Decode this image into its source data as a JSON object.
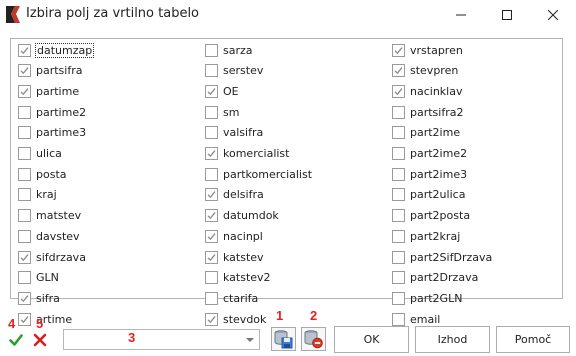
{
  "window": {
    "title": "Izbira polj za vrtilno tabelo",
    "minimize_glyph": "—",
    "maximize_glyph": "☐",
    "close_glyph": "✕"
  },
  "columns": [
    [
      {
        "label": "datumzap",
        "checked": true
      },
      {
        "label": "partsifra",
        "checked": true
      },
      {
        "label": "partime",
        "checked": true
      },
      {
        "label": "partime2",
        "checked": false
      },
      {
        "label": "partime3",
        "checked": false
      },
      {
        "label": "ulica",
        "checked": false
      },
      {
        "label": "posta",
        "checked": false
      },
      {
        "label": "kraj",
        "checked": false
      },
      {
        "label": "matstev",
        "checked": false
      },
      {
        "label": "davstev",
        "checked": false
      },
      {
        "label": "sifdrzava",
        "checked": true
      },
      {
        "label": "GLN",
        "checked": false
      },
      {
        "label": "sifra",
        "checked": true
      },
      {
        "label": "artime",
        "checked": true
      }
    ],
    [
      {
        "label": "sarza",
        "checked": false
      },
      {
        "label": "serstev",
        "checked": false
      },
      {
        "label": "OE",
        "checked": true
      },
      {
        "label": "sm",
        "checked": false
      },
      {
        "label": "valsifra",
        "checked": false
      },
      {
        "label": "komercialist",
        "checked": true
      },
      {
        "label": "partkomercialist",
        "checked": false
      },
      {
        "label": "delsifra",
        "checked": true
      },
      {
        "label": "datumdok",
        "checked": true
      },
      {
        "label": "nacinpl",
        "checked": true
      },
      {
        "label": "katstev",
        "checked": true
      },
      {
        "label": "katstev2",
        "checked": false
      },
      {
        "label": "ctarifa",
        "checked": false
      },
      {
        "label": "stevdok",
        "checked": true
      }
    ],
    [
      {
        "label": "vrstapren",
        "checked": true
      },
      {
        "label": "stevpren",
        "checked": true
      },
      {
        "label": "nacinklav",
        "checked": true
      },
      {
        "label": "partsifra2",
        "checked": false
      },
      {
        "label": "part2ime",
        "checked": false
      },
      {
        "label": "part2ime2",
        "checked": false
      },
      {
        "label": "part2ime3",
        "checked": false
      },
      {
        "label": "part2ulica",
        "checked": false
      },
      {
        "label": "part2posta",
        "checked": false
      },
      {
        "label": "part2kraj",
        "checked": false
      },
      {
        "label": "part2SifDrzava",
        "checked": false
      },
      {
        "label": "part2Drzava",
        "checked": false
      },
      {
        "label": "part2GLN",
        "checked": false
      },
      {
        "label": "email",
        "checked": false
      }
    ]
  ],
  "combo": {
    "value": ""
  },
  "buttons": {
    "ok": "OK",
    "izhod": "Izhod",
    "pomoc": "Pomoč"
  },
  "annotations": {
    "a1": "1",
    "a2": "2",
    "a3": "3",
    "a4": "4",
    "a5": "5"
  },
  "icons": {
    "app": "app-logo-icon",
    "check": "green-check-icon",
    "x": "red-x-icon",
    "save": "save-database-icon",
    "delete": "delete-database-icon"
  },
  "colors": {
    "check": "#2e9e2e",
    "x": "#d42020",
    "annotation": "#e02424",
    "checkmark": "#8a8a8a"
  }
}
